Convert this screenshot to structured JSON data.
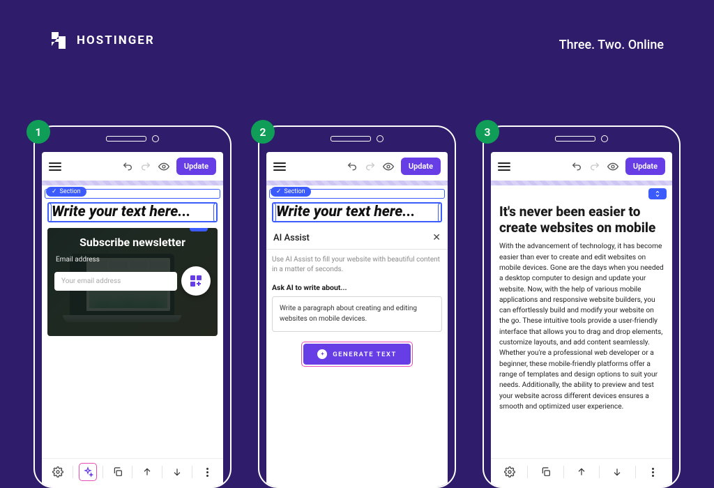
{
  "brand": "HOSTINGER",
  "tagline": "Three. Two. Online",
  "toolbar": {
    "update": "Update"
  },
  "section_tag": "Section",
  "headline_placeholder": "Write your text here...",
  "phone1": {
    "subheading": "Subscribe newsletter",
    "email_label": "Email address",
    "email_placeholder": "Your email address"
  },
  "phone2": {
    "ai_title": "AI Assist",
    "ai_sub": "Use AI Assist to fill your website with beautiful content in a matter of seconds.",
    "ai_ask_label": "Ask AI to write about...",
    "ai_prompt": "Write a paragraph about creating and editing websites on mobile devices.",
    "generate": "GENERATE TEXT"
  },
  "phone3": {
    "title": "It's never been easier to create websites on mobile",
    "body": "With the advancement of technology, it has become easier than ever to create and edit websites on mobile devices. Gone are the days when you needed a desktop computer to design and update your website. Now, with the help of various mobile applications and responsive website builders, you can effortlessly build and modify your website on the go. These intuitive tools provide a user-friendly interface that allows you to drag and drop elements, customize layouts, and add content seamlessly. Whether you're a professional web developer or a beginner, these mobile-friendly platforms offer a range of templates and design options to suit your needs. Additionally, the ability to preview and test your website across different devices ensures a smooth and optimized user experience."
  },
  "steps": [
    "1",
    "2",
    "3"
  ]
}
